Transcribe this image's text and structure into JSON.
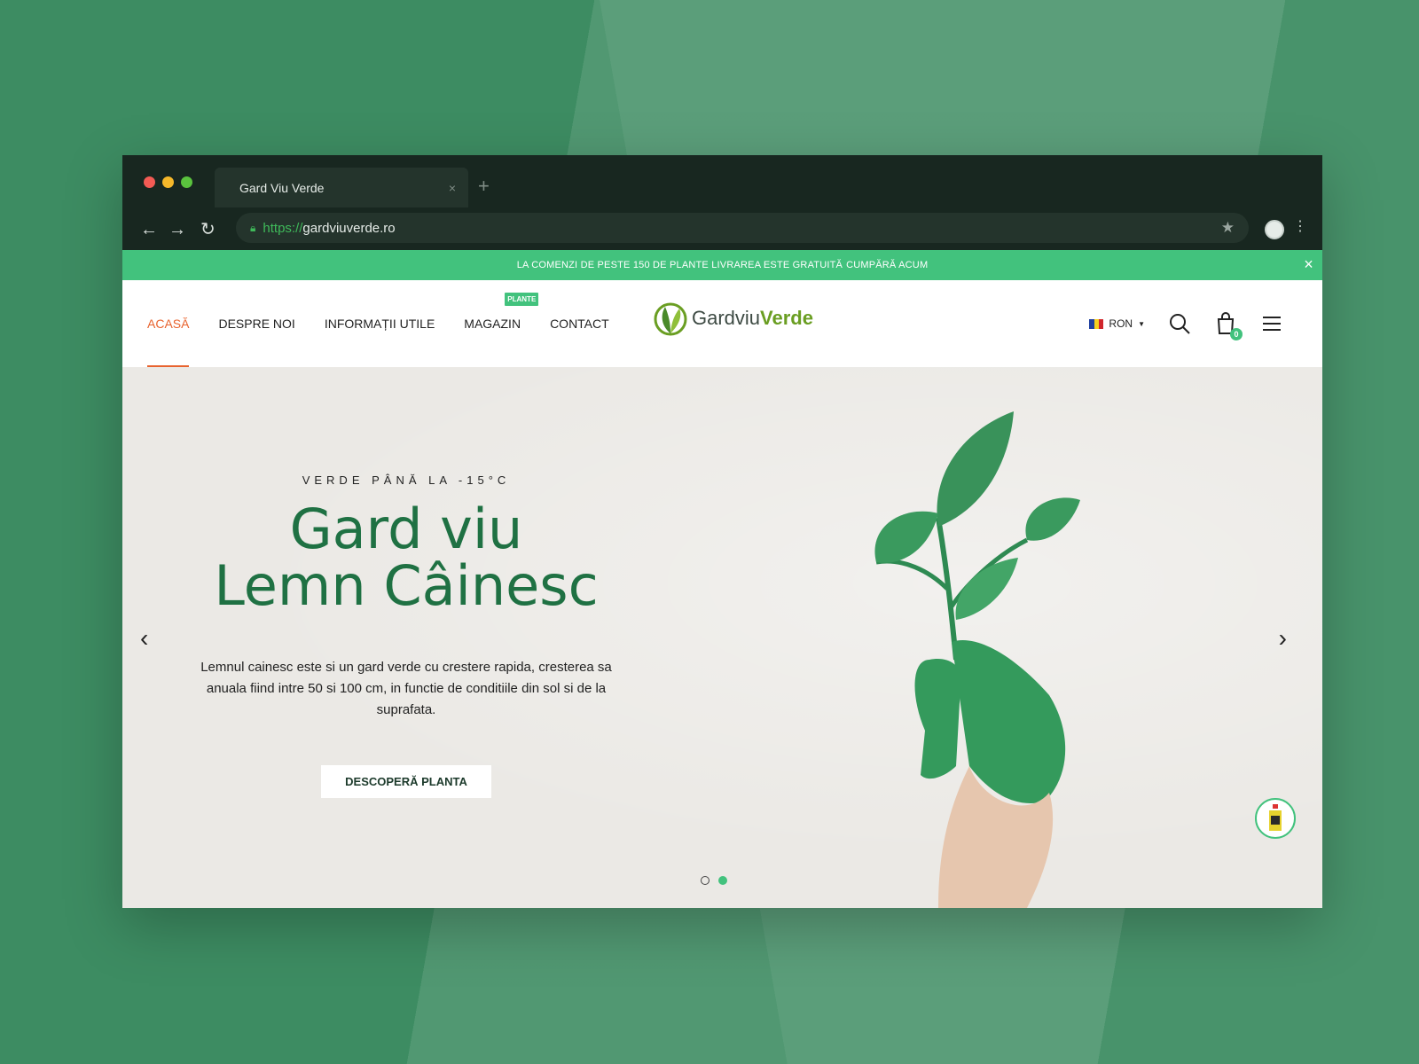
{
  "browser": {
    "tab_title": "Gard Viu Verde",
    "tab_close": "×",
    "new_tab": "+",
    "url_protocol": "https://",
    "url_host": "gardviuverde.ro"
  },
  "announcement": {
    "text": "LA COMENZI DE PESTE 150 DE PLANTE LIVRAREA ESTE GRATUITĂ",
    "cta": "CUMPĂRĂ ACUM",
    "close": "×"
  },
  "nav": {
    "items": [
      {
        "label": "ACASĂ"
      },
      {
        "label": "DESPRE NOI"
      },
      {
        "label": "INFORMAȚII UTILE"
      },
      {
        "label": "MAGAZIN",
        "badge": "PLANTE"
      },
      {
        "label": "CONTACT"
      }
    ]
  },
  "logo": {
    "part1": "Gardviu",
    "part2": "Verde"
  },
  "header": {
    "currency": "RON",
    "cart_count": "0"
  },
  "hero": {
    "kicker": "VERDE PÂNĂ LA -15°C",
    "title_line1": "Gard viu",
    "title_line2": "Lemn Câinesc",
    "description": "Lemnul cainesc este si un gard verde cu crestere rapida, cresterea sa anuala fiind intre 50 si 100 cm, in functie de conditiile din sol si de la suprafata.",
    "button": "DESCOPERĂ PLANTA",
    "active_slide": 2,
    "total_slides": 2
  },
  "colors": {
    "accent_green": "#42c27d",
    "title_green": "#1f7143",
    "active_nav": "#e8632e",
    "hero_bg": "#ebe9e5"
  }
}
